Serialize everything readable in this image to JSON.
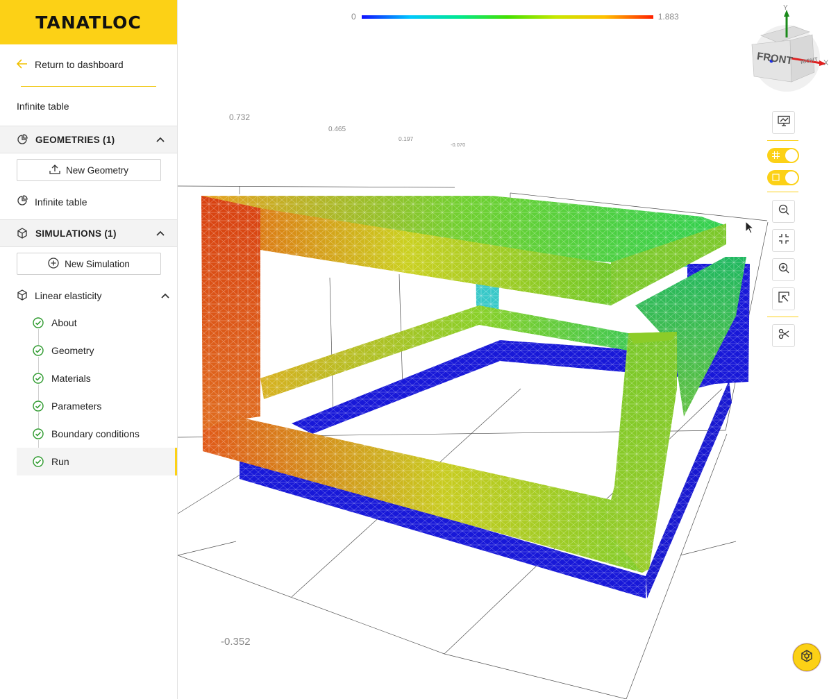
{
  "app": {
    "logo": "TANATLOC"
  },
  "sidebar": {
    "back_label": "Return to dashboard",
    "project_name": "Infinite table",
    "geometries": {
      "title": "GEOMETRIES (1)",
      "new_button": "New Geometry",
      "items": [
        "Infinite table"
      ]
    },
    "simulations": {
      "title": "SIMULATIONS (1)",
      "new_button": "New Simulation",
      "current": "Linear elasticity",
      "steps": [
        {
          "label": "About",
          "status": "done"
        },
        {
          "label": "Geometry",
          "status": "done"
        },
        {
          "label": "Materials",
          "status": "done"
        },
        {
          "label": "Parameters",
          "status": "done"
        },
        {
          "label": "Boundary conditions",
          "status": "done"
        },
        {
          "label": "Run",
          "status": "done",
          "active": true
        }
      ]
    }
  },
  "viewer": {
    "colorbar": {
      "min": "0",
      "max": "1.883",
      "colormap": "rainbow"
    },
    "axis_ticks": [
      "0.732",
      "0.465",
      "0.197",
      "-0.070",
      "-0.352"
    ],
    "view_cube": {
      "face_front": "FRONT",
      "face_right": "RIGHT",
      "axis_x": "X",
      "axis_y": "Y"
    },
    "toolbar": [
      "screenshot-icon",
      "grid-toggle",
      "box-toggle",
      "zoom-out-icon",
      "fit-view-icon",
      "zoom-in-icon",
      "zoom-selection-icon",
      "clip-icon"
    ]
  },
  "colors": {
    "accent": "#fcd116",
    "check": "#2e9a2e"
  }
}
